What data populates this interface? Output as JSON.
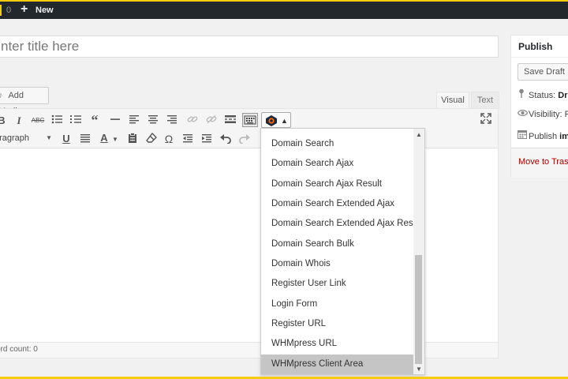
{
  "admin_bar": {
    "comment_count": "0",
    "new_label": "New",
    "new_icon": "plus-icon"
  },
  "title_field": {
    "placeholder": "nter title here"
  },
  "media": {
    "add_media_label": "Add Media",
    "icon": "media-icon"
  },
  "editor_tabs": {
    "visual": "Visual",
    "text": "Text"
  },
  "toolbar": {
    "format_select_value": "aragraph",
    "buttons_row1": [
      "bold",
      "italic",
      "strikethrough",
      "bullet-list",
      "numbered-list",
      "blockquote",
      "horizontal-rule",
      "align-left",
      "align-center",
      "align-right",
      "insert-link",
      "remove-link",
      "read-more",
      "toolbar-toggle",
      "shortcode-menu",
      "fullscreen"
    ],
    "buttons_row2": [
      "format",
      "underline",
      "justify",
      "text-color",
      "paste-as-text",
      "clear-formatting",
      "special-character",
      "outdent",
      "indent",
      "undo",
      "redo"
    ]
  },
  "status_bar": {
    "word_count": "ord count: 0"
  },
  "shortcode_dropdown": {
    "items": [
      "Domain Search",
      "Domain Search Ajax",
      "Domain Search Ajax Result",
      "Domain Search Extended Ajax",
      "Domain Search Extended Ajax Result",
      "Domain Search Bulk",
      "Domain Whois",
      "Register User Link",
      "Login Form",
      "Register URL",
      "WHMpress URL",
      "WHMpress Client Area"
    ],
    "selected": "WHMpress Client Area"
  },
  "publish_box": {
    "title": "Publish",
    "save_draft": "Save Draft",
    "status_label": "Status: ",
    "status_value": "Dr",
    "visibility_label": "Visibility: P",
    "publish_label": "Publish ",
    "publish_value": "im",
    "move_to_trash": "Move to Trash"
  },
  "colors": {
    "admin_bar": "#23282d",
    "frame_accent": "#f5cc0e",
    "trash_link": "#aa0000",
    "dropdown_selected": "#c5c5c5"
  }
}
